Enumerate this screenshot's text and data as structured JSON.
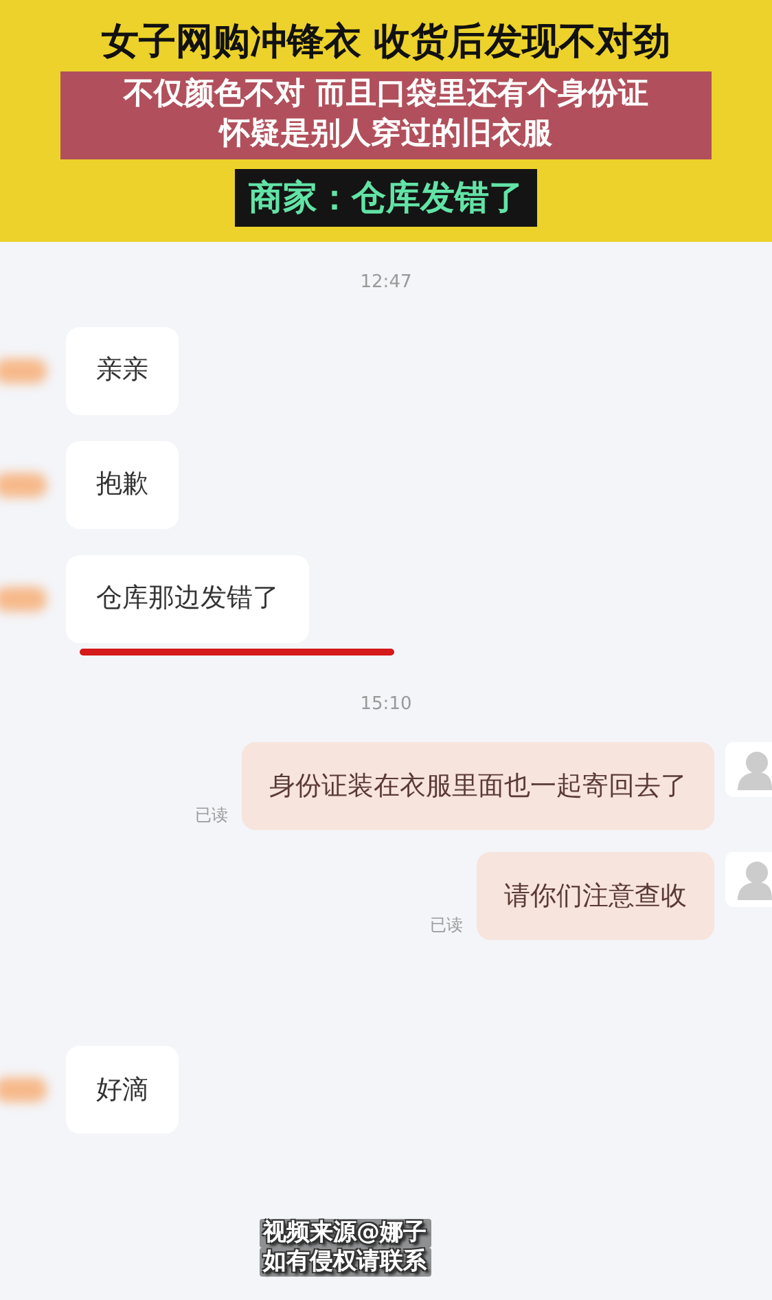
{
  "headline": {
    "title": "女子网购冲锋衣 收货后发现不对劲",
    "subtitle_lines": [
      "不仅颜色不对 而且口袋里还有个身份证",
      "怀疑是别人穿过的旧衣服"
    ],
    "tag": "商家：仓库发错了"
  },
  "chat": [
    {
      "kind": "time",
      "text": "12:47"
    },
    {
      "kind": "incoming",
      "text": "亲亲",
      "underlined": false
    },
    {
      "kind": "incoming",
      "text": "抱歉",
      "underlined": false
    },
    {
      "kind": "incoming",
      "text": "仓库那边发错了",
      "underlined": true
    },
    {
      "kind": "time",
      "text": "15:10"
    },
    {
      "kind": "outgoing",
      "text": "身份证装在衣服里面也一起寄回去了",
      "receipt": "已读"
    },
    {
      "kind": "outgoing",
      "text": "请你们注意查收",
      "receipt": "已读"
    },
    {
      "kind": "incoming",
      "text": "好滴",
      "underlined": false
    }
  ],
  "credit_lines": [
    "视频来源@娜子",
    "如有侵权请联系"
  ]
}
